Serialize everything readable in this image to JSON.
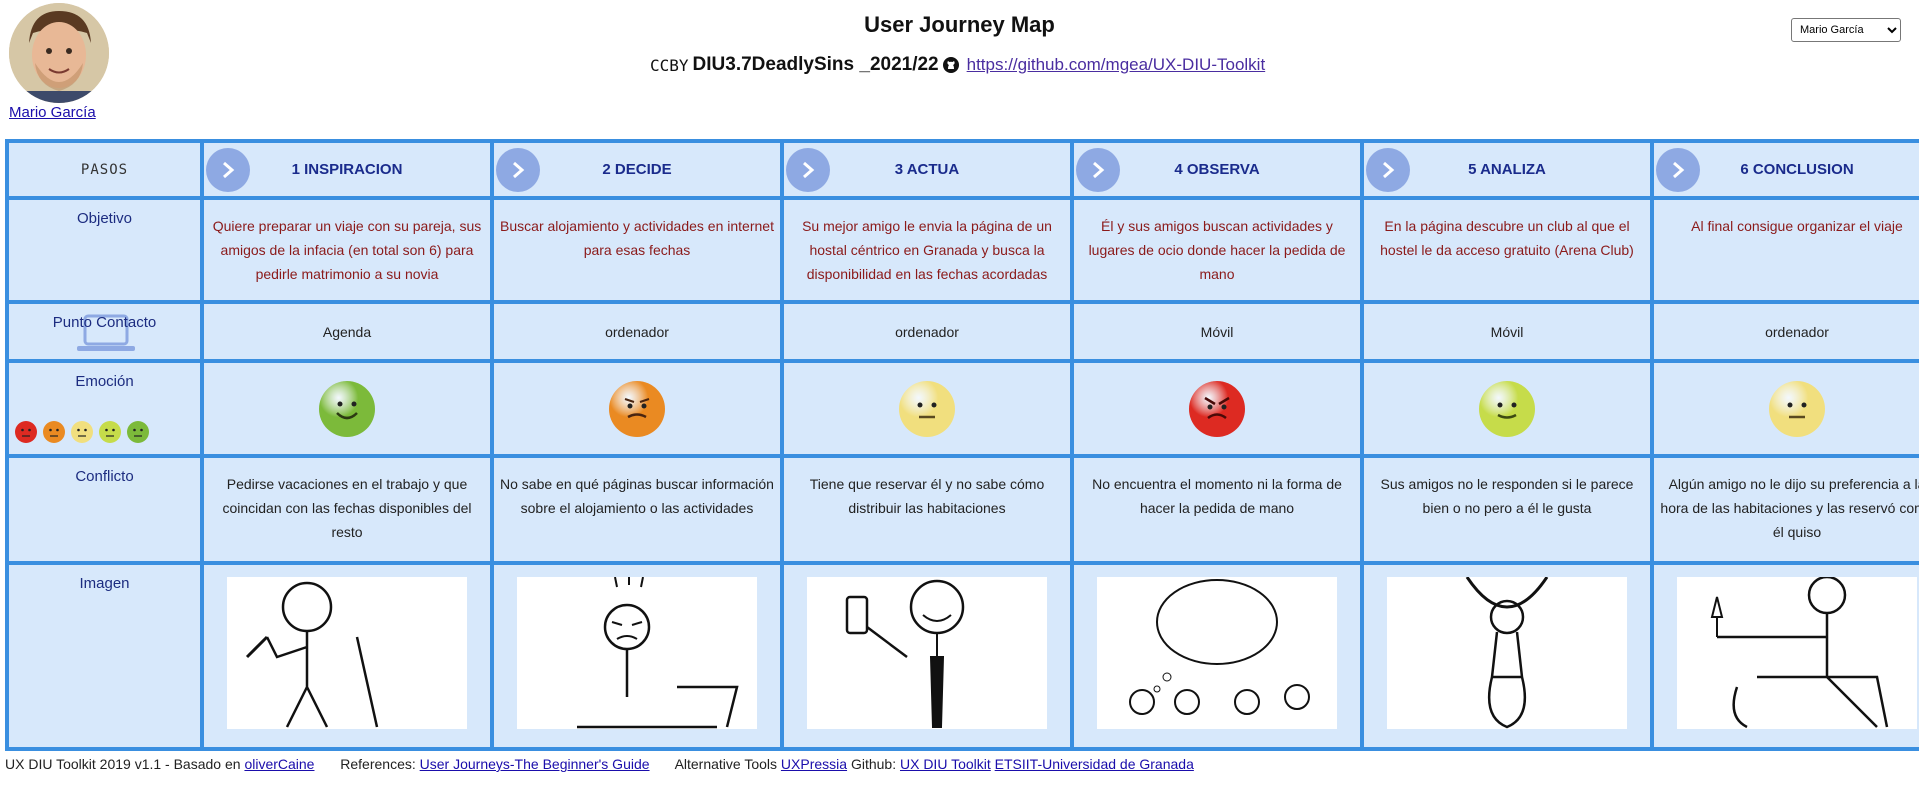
{
  "header": {
    "title": "User Journey Map",
    "license": "CCBY",
    "repo_name": "DIU3.7DeadlySins _2021/22",
    "repo_link": "https://github.com/mgea/UX-DIU-Toolkit",
    "author_name": "Mario García",
    "user_select_value": "Mario García"
  },
  "rows": {
    "pasos": "PASOS",
    "objetivo": "Objetivo",
    "contacto": "Punto Contacto",
    "emocion": "Emoción",
    "conflicto": "Conflicto",
    "imagen": "Imagen"
  },
  "steps": [
    {
      "title": "1 INSPIRACION",
      "objetivo": "Quiere preparar un viaje con su pareja, sus amigos de la infacia (en total son 6) para pedirle matrimonio a su novia",
      "contacto": "Agenda",
      "emotion": "happy",
      "emotion_color": "#7cba3a",
      "conflicto": "Pedirse vacaciones en el trabajo y que coincidan con las fechas disponibles del resto"
    },
    {
      "title": "2 DECIDE",
      "objetivo": "Buscar alojamiento y actividades en internet para esas fechas",
      "contacto": "ordenador",
      "emotion": "annoyed",
      "emotion_color": "#ea8a22",
      "conflicto": "No sabe en qué páginas buscar información sobre el alojamiento o las actividades"
    },
    {
      "title": "3 ACTUA",
      "objetivo": "Su mejor amigo le envia la página de un hostal céntrico en Granada y busca la disponibilidad en las fechas acordadas",
      "contacto": "ordenador",
      "emotion": "neutral",
      "emotion_color": "#f1df7e",
      "conflicto": "Tiene que reservar él y no sabe cómo distribuir las habitaciones"
    },
    {
      "title": "4 OBSERVA",
      "objetivo": "Él y sus amigos buscan actividades y lugares de ocio donde hacer la pedida de mano",
      "contacto": "Móvil",
      "emotion": "angry",
      "emotion_color": "#dd2a22",
      "conflicto": "No encuentra el momento ni la forma de hacer la pedida de mano"
    },
    {
      "title": "5 ANALIZA",
      "objetivo": "En la página descubre un club al que el hostel le da acceso gratuito (Arena Club)",
      "contacto": "Móvil",
      "emotion": "content",
      "emotion_color": "#c6dc4a",
      "conflicto": "Sus amigos no le responden si le parece bien o no pero a él le gusta"
    },
    {
      "title": "6 CONCLUSION",
      "objetivo": "Al final consigue organizar el viaje",
      "contacto": "ordenador",
      "emotion": "neutral",
      "emotion_color": "#f1df7e",
      "conflicto": "Algún amigo no le dijo su preferencia a la hora de las habitaciones y las reservó como él quiso"
    }
  ],
  "emotion_scale": [
    "#dd2a22",
    "#ea8a22",
    "#f1df7e",
    "#c6dc4a",
    "#7cba3a"
  ],
  "footer": {
    "prefix": "UX DIU Toolkit 2019 v1.1 - Basado en",
    "based_link": "oliverCaine",
    "references_label": "References:",
    "references_link": "User Journeys-The Beginner's Guide",
    "alt_tools_label": "Alternative Tools",
    "alt_tools_link": "UXPressia",
    "github_label": "Github:",
    "github_link": "UX DIU Toolkit",
    "etsiit_link": "ETSIIT-Universidad de Granada"
  }
}
